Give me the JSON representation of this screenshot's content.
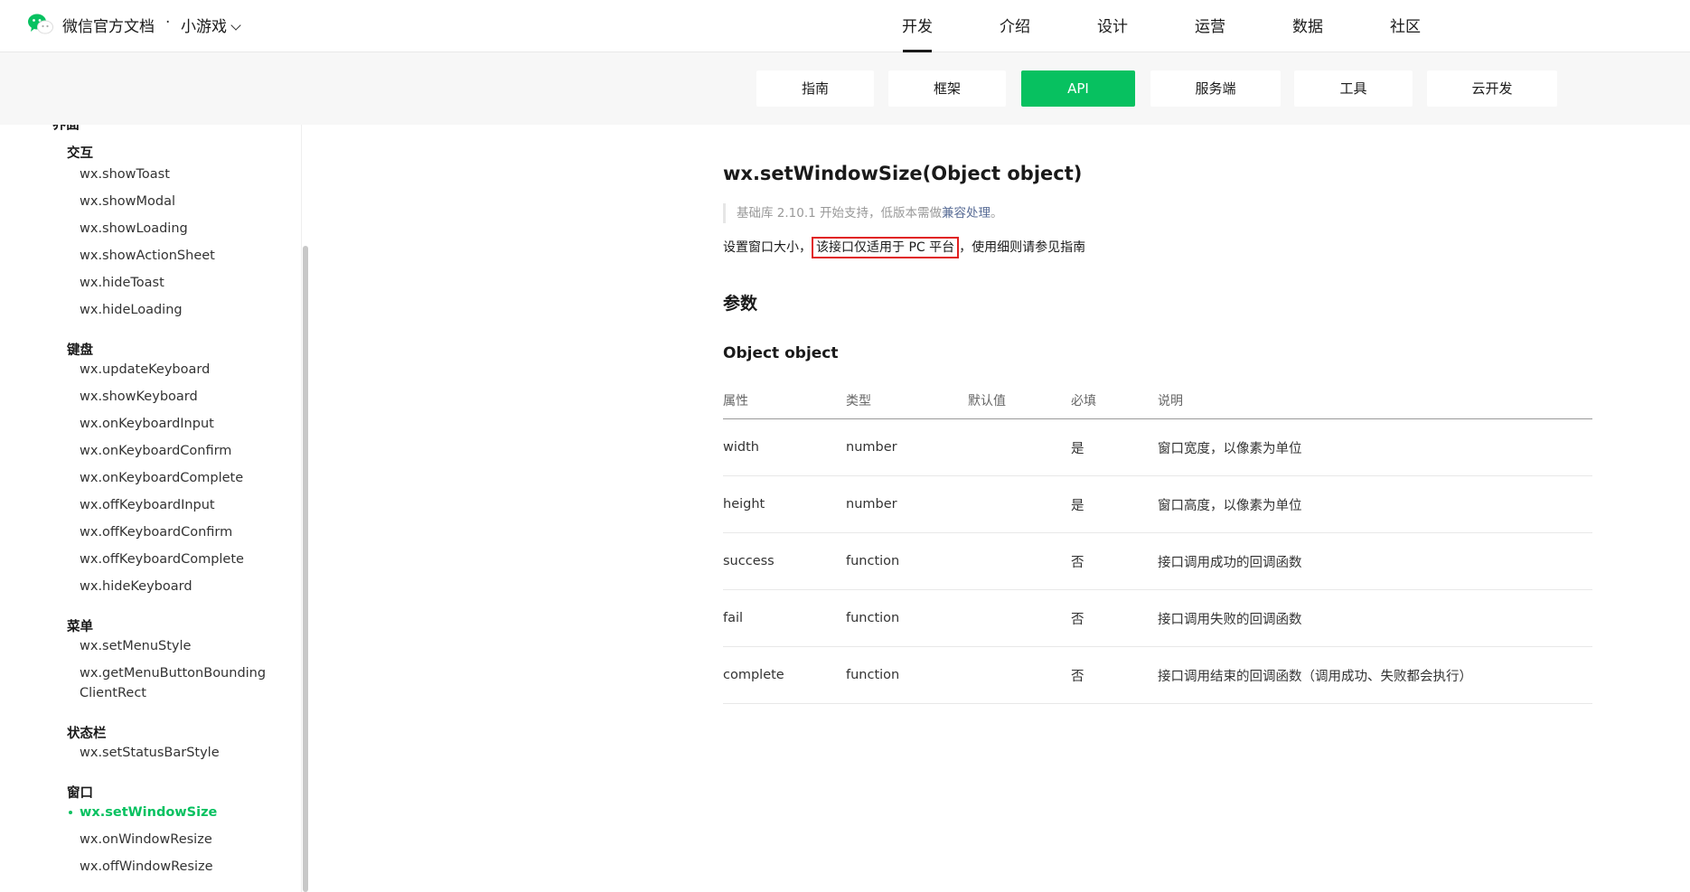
{
  "header": {
    "brand": "微信官方文档",
    "separator": "·",
    "product": "小游戏",
    "nav": [
      "开发",
      "介绍",
      "设计",
      "运营",
      "数据",
      "社区"
    ],
    "active_nav": "开发"
  },
  "subnav": {
    "items": [
      "指南",
      "框架",
      "API",
      "服务端",
      "工具",
      "云开发"
    ],
    "active": "API"
  },
  "sidebar": {
    "partial_heading": "界面",
    "groups": [
      {
        "title": "交互",
        "items": [
          "wx.showToast",
          "wx.showModal",
          "wx.showLoading",
          "wx.showActionSheet",
          "wx.hideToast",
          "wx.hideLoading"
        ]
      },
      {
        "title": "键盘",
        "items": [
          "wx.updateKeyboard",
          "wx.showKeyboard",
          "wx.onKeyboardInput",
          "wx.onKeyboardConfirm",
          "wx.onKeyboardComplete",
          "wx.offKeyboardInput",
          "wx.offKeyboardConfirm",
          "wx.offKeyboardComplete",
          "wx.hideKeyboard"
        ]
      },
      {
        "title": "菜单",
        "items": [
          "wx.setMenuStyle",
          "wx.getMenuButtonBoundingClientRect"
        ]
      },
      {
        "title": "状态栏",
        "items": [
          "wx.setStatusBarStyle"
        ]
      },
      {
        "title": "窗口",
        "items": [
          "wx.setWindowSize",
          "wx.onWindowResize",
          "wx.offWindowResize"
        ]
      }
    ],
    "active_item": "wx.setWindowSize"
  },
  "content": {
    "title": "wx.setWindowSize(Object object)",
    "since_prefix": "基础库 2.10.1 开始支持，低版本需做",
    "since_link": "兼容处理",
    "since_suffix": "。",
    "desc_prefix": "设置窗口大小，",
    "desc_highlight": "该接口仅适用于 PC 平台",
    "desc_middle": "，使用细则请参见",
    "desc_link": "指南",
    "params_heading": "参数",
    "object_heading": "Object object",
    "table": {
      "headers": [
        "属性",
        "类型",
        "默认值",
        "必填",
        "说明"
      ],
      "rows": [
        [
          "width",
          "number",
          "",
          "是",
          "窗口宽度，以像素为单位"
        ],
        [
          "height",
          "number",
          "",
          "是",
          "窗口高度，以像素为单位"
        ],
        [
          "success",
          "function",
          "",
          "否",
          "接口调用成功的回调函数"
        ],
        [
          "fail",
          "function",
          "",
          "否",
          "接口调用失败的回调函数"
        ],
        [
          "complete",
          "function",
          "",
          "否",
          "接口调用结束的回调函数（调用成功、失败都会执行）"
        ]
      ]
    }
  },
  "colors": {
    "accent": "#07c160",
    "highlight_border": "#e02020",
    "link": "#576b95"
  }
}
